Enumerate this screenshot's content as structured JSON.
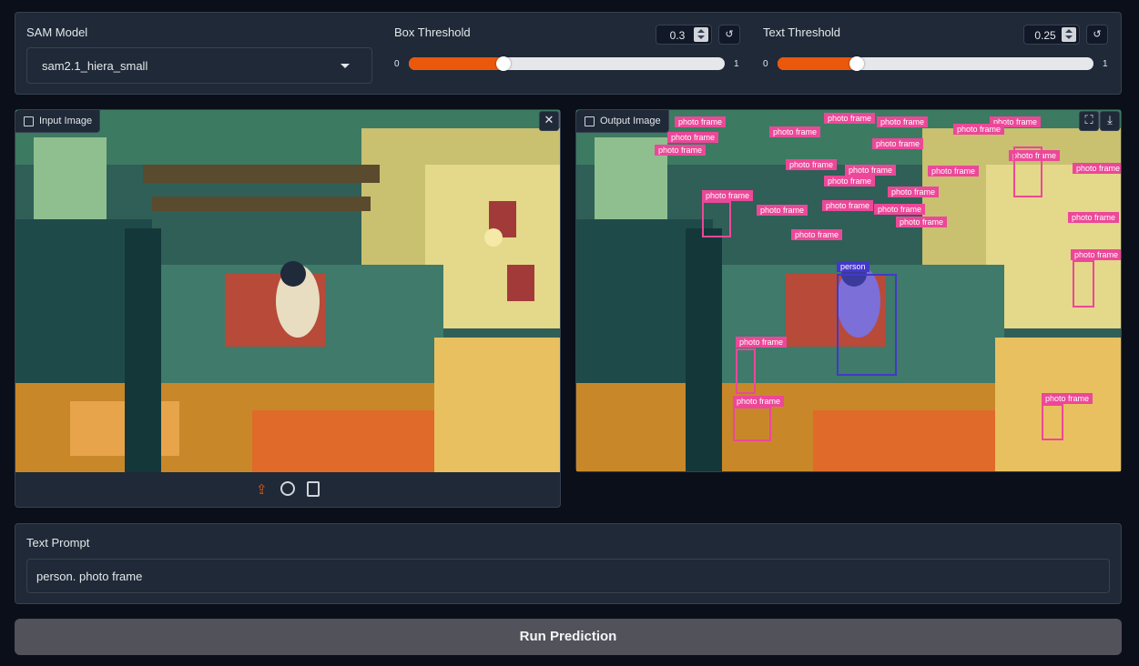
{
  "model": {
    "label": "SAM Model",
    "selected": "sam2.1_hiera_small"
  },
  "box_threshold": {
    "label": "Box Threshold",
    "value": "0.3",
    "min": "0",
    "max": "1",
    "level": 0.3
  },
  "text_threshold": {
    "label": "Text Threshold",
    "value": "0.25",
    "min": "0",
    "max": "1",
    "level": 0.25
  },
  "reset_glyph": "↺",
  "input_image": {
    "label": "Input Image"
  },
  "output_image": {
    "label": "Output Image"
  },
  "detections": {
    "frame_label": "photo frame",
    "person_label": "person"
  },
  "prompt": {
    "label": "Text Prompt",
    "value": "person. photo frame"
  },
  "run_button": "Run Prediction",
  "colors": {
    "accent": "#ea580c",
    "frame_box": "#ec4899",
    "person_box": "#4338ca"
  }
}
